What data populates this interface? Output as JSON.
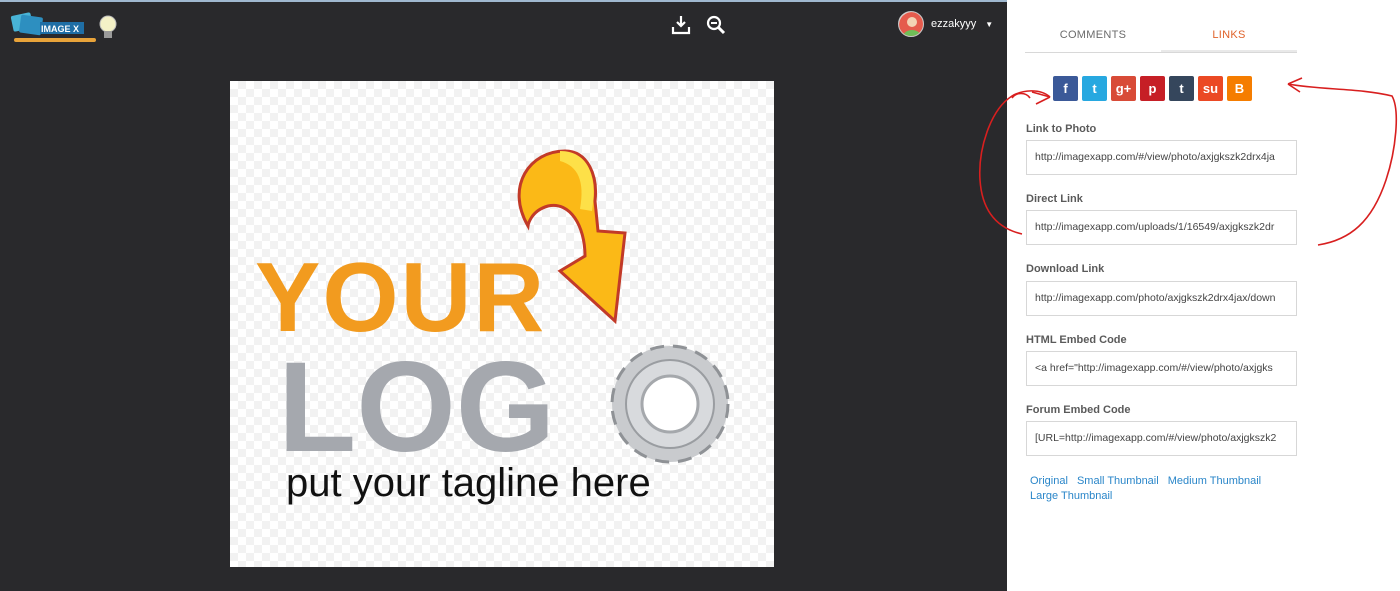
{
  "header": {
    "logo_text": "IMAGE X",
    "download_icon": "download-icon",
    "zoom_icon": "zoom-out-icon",
    "username": "ezzakyyy"
  },
  "photo": {
    "line1": "YOUR",
    "line2": "LOG",
    "tagline": "put your tagline here",
    "colors": {
      "orange": "#f29b1f",
      "gray": "#a5a8ae",
      "black": "#111111"
    }
  },
  "tabs": [
    {
      "label": "COMMENTS",
      "active": false
    },
    {
      "label": "LINKS",
      "active": true
    }
  ],
  "share": [
    {
      "name": "facebook",
      "glyph": "f",
      "color": "#3b5998"
    },
    {
      "name": "twitter",
      "glyph": "t",
      "color": "#27a8e0"
    },
    {
      "name": "google-plus",
      "glyph": "g+",
      "color": "#d84b37"
    },
    {
      "name": "pinterest",
      "glyph": "p",
      "color": "#c61f26"
    },
    {
      "name": "tumblr",
      "glyph": "t",
      "color": "#35465c"
    },
    {
      "name": "stumbleupon",
      "glyph": "su",
      "color": "#eb4924"
    },
    {
      "name": "blogger",
      "glyph": "B",
      "color": "#f57d00"
    }
  ],
  "links": [
    {
      "label": "Link to Photo",
      "value": "http://imagexapp.com/#/view/photo/axjgkszk2drx4ja"
    },
    {
      "label": "Direct Link",
      "value": "http://imagexapp.com/uploads/1/16549/axjgkszk2dr"
    },
    {
      "label": "Download Link",
      "value": "http://imagexapp.com/photo/axjgkszk2drx4jax/down"
    },
    {
      "label": "HTML Embed Code",
      "value": "<a href=\"http://imagexapp.com/#/view/photo/axjgks"
    },
    {
      "label": "Forum Embed Code",
      "value": "[URL=http://imagexapp.com/#/view/photo/axjgkszk2"
    }
  ],
  "sizes": [
    "Original",
    "Small Thumbnail",
    "Medium Thumbnail",
    "Large Thumbnail"
  ],
  "accent": "#e0632b",
  "link_color": "#2a86c9"
}
